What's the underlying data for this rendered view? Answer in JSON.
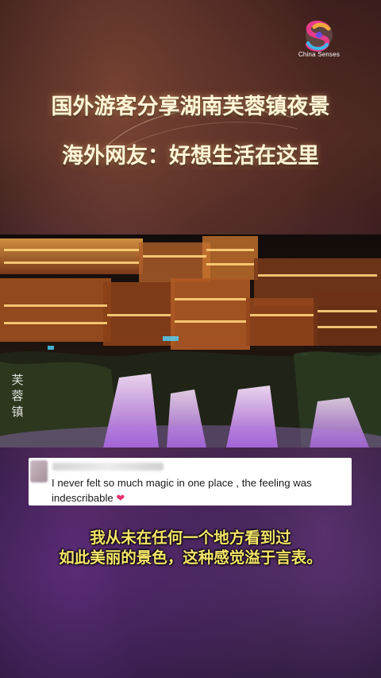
{
  "brand": {
    "name": "China Senses",
    "logo_icon": "china-senses-logo-icon",
    "colors": [
      "#e63b8a",
      "#f2a93b",
      "#3bb8e6",
      "#6a4de0"
    ]
  },
  "headline": {
    "line1": "国外游客分享湖南芙蓉镇夜景",
    "line2": "海外网友：好想生活在这里"
  },
  "photo": {
    "vertical_text": "芙蓉镇"
  },
  "comment": {
    "text": "I never felt so much magic in one place , the feeling was indescribable",
    "heart_icon": "heart-icon"
  },
  "subtitle": {
    "line1": "我从未在任何一个地方看到过",
    "line2": "如此美丽的景色，这种感觉溢于言表。"
  }
}
